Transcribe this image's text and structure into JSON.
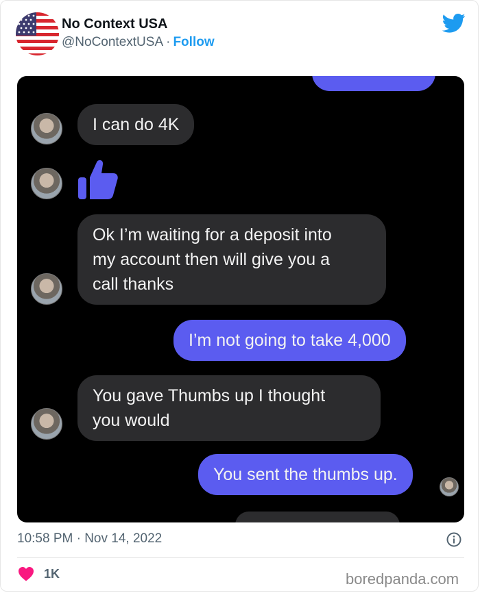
{
  "tweet": {
    "name": "No Context USA",
    "handle": "@NoContextUSA",
    "separator": "·",
    "follow_label": "Follow",
    "timestamp": "10:58 PM · Nov 14, 2022",
    "likes": "1K",
    "watermark": "boredpanda.com"
  },
  "messages": [
    {
      "side": "in",
      "text": "I can do 4K"
    },
    {
      "side": "in",
      "text": "👍"
    },
    {
      "side": "in",
      "text": "Ok I’m waiting for a deposit into\nmy account then  will give you a\ncall  thanks"
    },
    {
      "side": "out",
      "text": "I’m not going to take 4,000"
    },
    {
      "side": "in",
      "text": "You gave Thumbs up  I thought\nyou would"
    },
    {
      "side": "out",
      "text": "You sent the thumbs up."
    }
  ],
  "colors": {
    "accent": "#1d9bf0",
    "outgoing_bubble": "#5b5cf0",
    "incoming_bubble": "#2c2c2e",
    "heart": "#f91880"
  },
  "icons": [
    "usa-flag-avatar",
    "twitter-bird-icon",
    "thumbs-up-icon",
    "info-icon",
    "heart-icon"
  ]
}
